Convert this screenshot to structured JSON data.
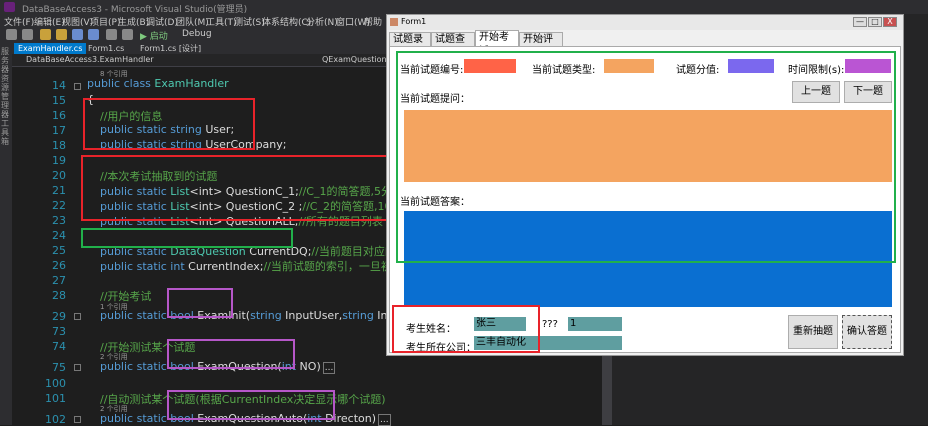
{
  "vs": {
    "title": "DataBaseAccess3 - Microsoft Visual Studio(管理员)",
    "menu": [
      "文件(F)",
      "编辑(E)",
      "视图(V)",
      "项目(P)",
      "生成(B)",
      "调试(D)",
      "团队(M)",
      "工具(T)",
      "测试(S)",
      "体系结构(C)",
      "分析(N)",
      "窗口(W)",
      "帮助"
    ],
    "toolbar": {
      "start": "▶ 启动",
      "config": "Debug"
    },
    "left_strip": "服务器资源管理器工具箱",
    "tabs": [
      "ExamHandler.cs",
      "Form1.cs",
      "Form1.cs [设计]"
    ],
    "nav": {
      "left": "DataBaseAccess3.ExamHandler",
      "right": "QExamQuestionAuto("
    }
  },
  "code": {
    "refs": {
      "r13": "8 个引用",
      "r29": "1 个引用",
      "r75": "2 个引用",
      "r102": "2 个引用"
    },
    "lines": [
      {
        "num": "14",
        "kw": "public class ",
        "ty": "ExamHandler",
        "rest": ""
      },
      {
        "num": "15",
        "kw": "",
        "ty": "",
        "rest": "{"
      },
      {
        "num": "16",
        "cm": "//用户的信息"
      },
      {
        "num": "17",
        "kw": "public static string ",
        "rest": "User;"
      },
      {
        "num": "18",
        "kw": "public static string ",
        "rest": "UserCompany;"
      },
      {
        "num": "19",
        "rest": ""
      },
      {
        "num": "20",
        "cm": "//本次考试抽取到的试题"
      },
      {
        "num": "21",
        "kw": "public static ",
        "ty": "List",
        "rest": "<int> QuestionC_1;",
        "cm": "//C_1的简答题,5分一个"
      },
      {
        "num": "22",
        "kw": "public static ",
        "ty": "List",
        "rest": "<int> QuestionC_2 ;",
        "cm": "//C_2的简答题,10分一个"
      },
      {
        "num": "23",
        "kw": "public static ",
        "ty": "List",
        "rest": "<int> QuestionALL;",
        "cm": "//所有的题目列表"
      },
      {
        "num": "24",
        "rest": ""
      },
      {
        "num": "25",
        "kw": "public static ",
        "ty": "DataQuestion",
        "rest": " CurrentDQ;",
        "cm": "//当前题目对应的结构的"
      },
      {
        "num": "26",
        "kw": "public static int ",
        "rest": "CurrentIndex;",
        "cm": "//当前试题的索引，一旦初始化则"
      },
      {
        "num": "27",
        "rest": ""
      },
      {
        "num": "28",
        "cm": "//开始考试"
      },
      {
        "num": "29",
        "kw": "public static bool ",
        "rest": "ExamInit(",
        "kw2": "string",
        "rest2": " InputUser,",
        "kw3": "string",
        "rest3": " InputUser"
      },
      {
        "num": "73",
        "rest": ""
      },
      {
        "num": "74",
        "cm": "//开始测试某个试题"
      },
      {
        "num": "75",
        "kw": "public static bool ",
        "rest": "ExamQuestion(",
        "kw2": "int",
        "rest2": " NO)",
        "rest3": "..."
      },
      {
        "num": "100",
        "rest": ""
      },
      {
        "num": "101",
        "cm": "//自动测试某个试题(根据CurrentIndex决定显示哪个试题)"
      },
      {
        "num": "102",
        "kw": "public static bool ",
        "rest": "ExamQuestionAuto(",
        "kw2": "int",
        "rest2": " Directon)",
        "rest3": "..."
      },
      {
        "num": "127",
        "rest": ""
      }
    ]
  },
  "form": {
    "title": "Form1",
    "window_buttons": [
      "—",
      "□",
      "X"
    ],
    "tabs": [
      "试题录入",
      "试题查看",
      "开始考试",
      "开始评分"
    ],
    "selected_tab": "开始考试",
    "labels": {
      "q_no": "当前试题编号:",
      "q_type": "当前试题类型:",
      "q_score": "试题分值:",
      "q_time": "时间限制(s):",
      "q_text": "当前试题提问：",
      "q_answer": "当前试题答案：",
      "name": "考生姓名：",
      "company": "考生所在公司：",
      "unknown": "???"
    },
    "buttons": {
      "prev": "上一题",
      "next": "下一题",
      "redraw": "重新抽题",
      "confirm": "确认答题"
    },
    "values": {
      "name": "张三",
      "company": "三丰自动化",
      "index": "1"
    },
    "colors": {
      "q_no": "#ff6347",
      "q_type": "#f4a460",
      "q_score": "#7b68ee",
      "q_time": "#ba55d3",
      "question": "#f4a460",
      "answer": "#0a6fd1",
      "textbox": "#5f9ea0"
    }
  },
  "annotations": {
    "red": "#e8232a",
    "green": "#21b04b",
    "purple": "#b657c8"
  }
}
